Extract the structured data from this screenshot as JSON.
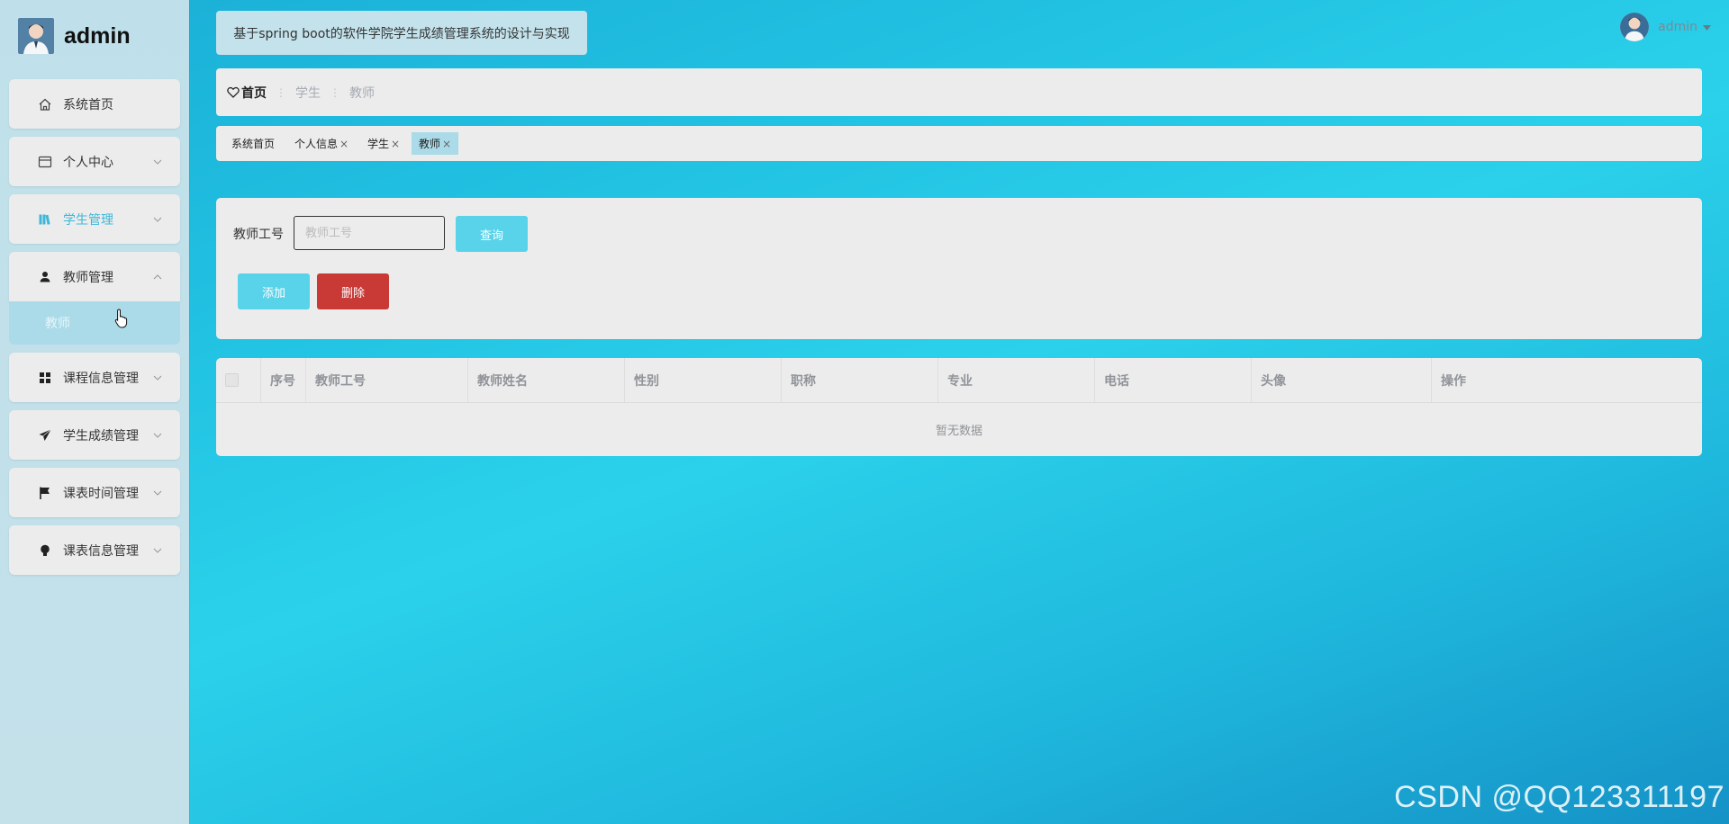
{
  "brand": {
    "name": "admin"
  },
  "header": {
    "system_title": "基于spring boot的软件学院学生成绩管理系统的设计与实现",
    "user_name": "admin"
  },
  "sidebar": {
    "items": [
      {
        "label": "系统首页",
        "icon": "home-icon",
        "has_arrow": false
      },
      {
        "label": "个人中心",
        "icon": "card-icon",
        "has_arrow": true
      },
      {
        "label": "学生管理",
        "icon": "book-icon",
        "has_arrow": true
      },
      {
        "label": "教师管理",
        "icon": "user-icon",
        "has_arrow": true,
        "expanded": true
      },
      {
        "label": "课程信息管理",
        "icon": "grid-icon",
        "has_arrow": true
      },
      {
        "label": "学生成绩管理",
        "icon": "paper-plane-icon",
        "has_arrow": true
      },
      {
        "label": "课表时间管理",
        "icon": "flag-icon",
        "has_arrow": true
      },
      {
        "label": "课表信息管理",
        "icon": "bulb-icon",
        "has_arrow": true
      }
    ],
    "sub_item": "教师"
  },
  "breadcrumb": {
    "home": "首页",
    "items": [
      "学生",
      "教师"
    ]
  },
  "tabs": [
    {
      "label": "系统首页",
      "closable": false
    },
    {
      "label": "个人信息",
      "closable": true
    },
    {
      "label": "学生",
      "closable": true
    },
    {
      "label": "教师",
      "closable": true,
      "active": true
    }
  ],
  "search": {
    "label": "教师工号",
    "placeholder": "教师工号",
    "query_label": "查询",
    "add_label": "添加",
    "delete_label": "删除"
  },
  "table": {
    "columns": [
      "序号",
      "教师工号",
      "教师姓名",
      "性别",
      "职称",
      "专业",
      "电话",
      "头像",
      "操作"
    ],
    "empty_text": "暂无数据"
  },
  "watermark": "CSDN @QQ123311197",
  "colors": {
    "accent": "#58d3ea",
    "danger": "#c93a37",
    "active_menu_text": "#3fb7d8"
  }
}
